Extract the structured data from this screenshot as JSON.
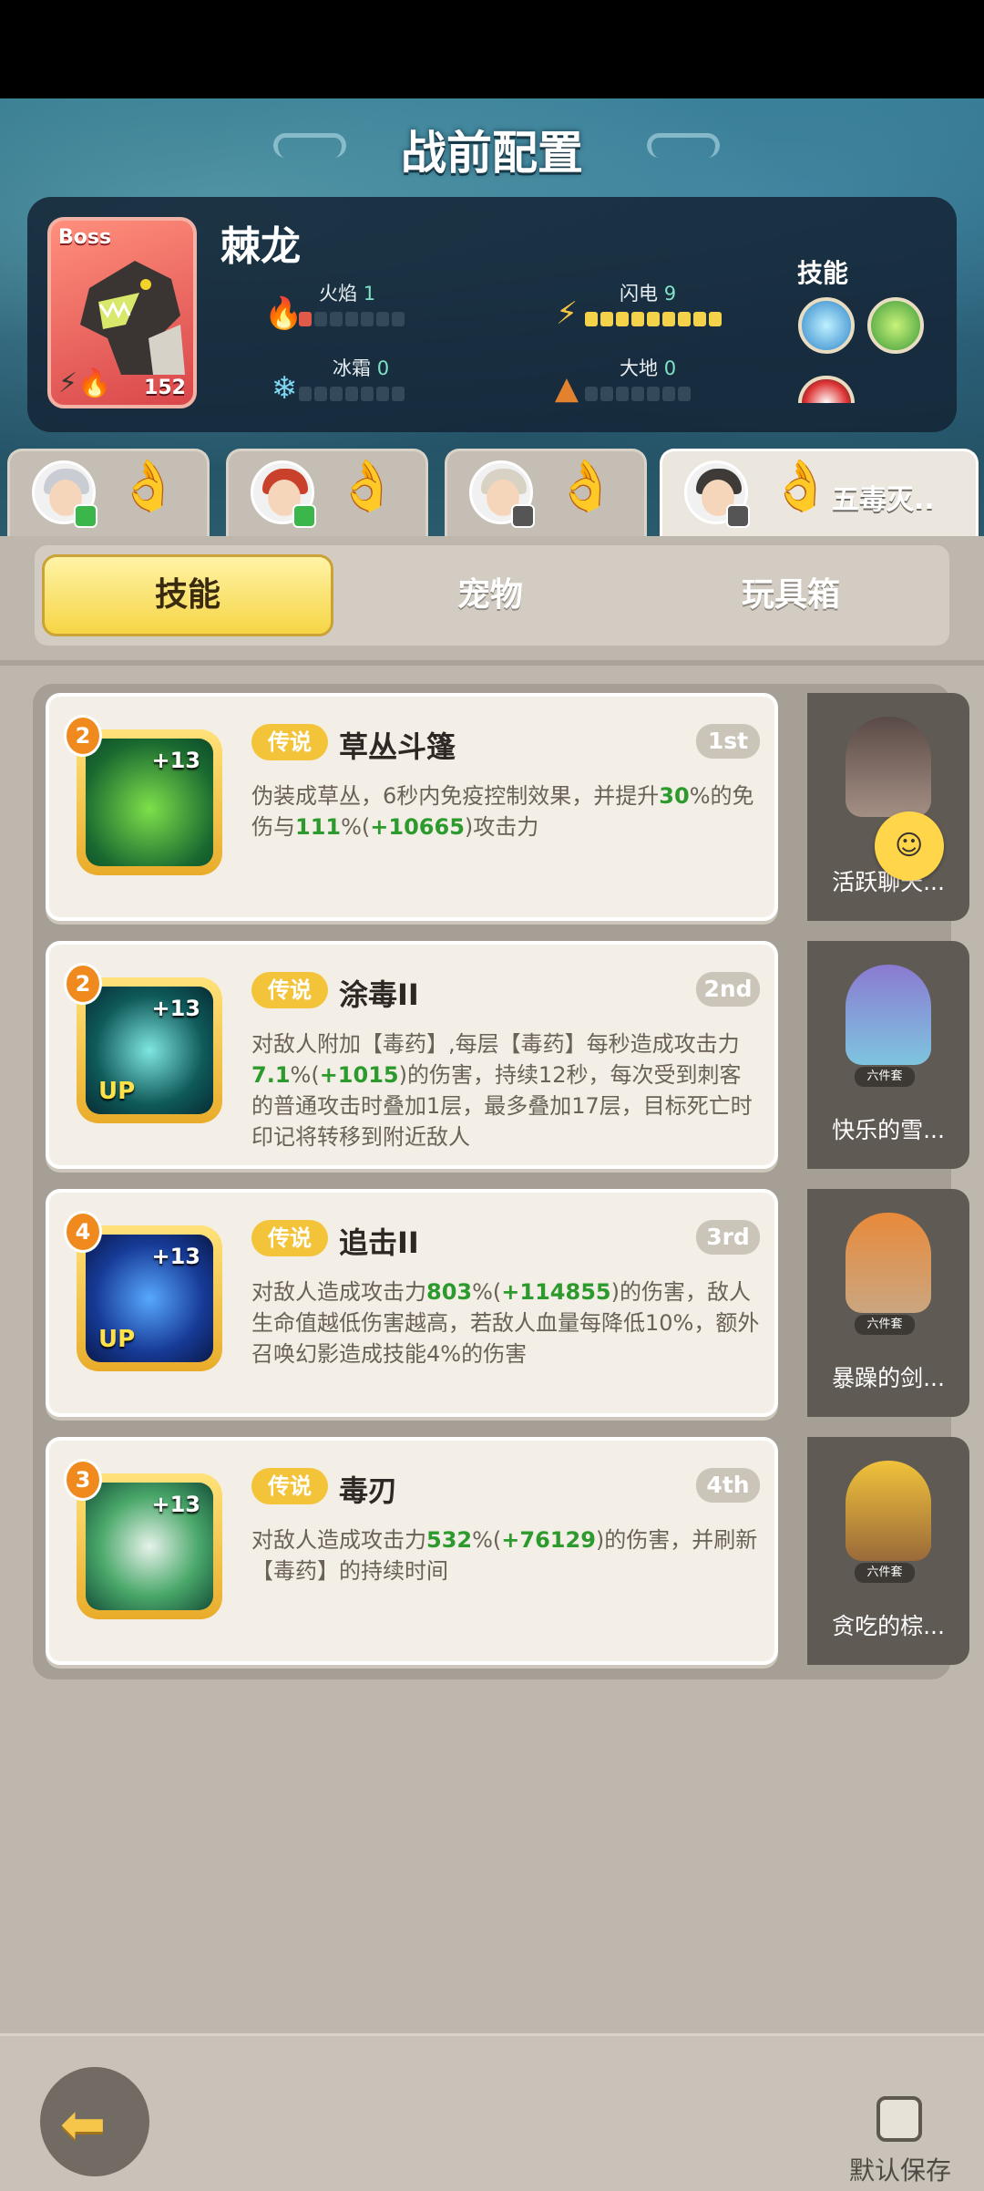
{
  "page": {
    "title": "战前配置"
  },
  "boss": {
    "tag": "Boss",
    "name": "棘龙",
    "level": "152",
    "elements": [
      {
        "label": "火焰",
        "value": "1",
        "icon": "fire-icon"
      },
      {
        "label": "闪电",
        "value": "9",
        "icon": "lightning-icon"
      },
      {
        "label": "冰霜",
        "value": "0",
        "icon": "snowflake-icon"
      },
      {
        "label": "大地",
        "value": "0",
        "icon": "earth-icon"
      }
    ],
    "skills_label": "技能"
  },
  "heroes": [
    {
      "name": ""
    },
    {
      "name": ""
    },
    {
      "name": ""
    },
    {
      "name": "五毒灭.."
    }
  ],
  "tabs": [
    "技能",
    "宠物",
    "玩具箱"
  ],
  "skills": [
    {
      "level": "2",
      "plus": "+13",
      "up": "",
      "rarity": "传说",
      "name": "草丛斗篷",
      "rank": "1st",
      "desc": [
        "伪装成草丛，6秒内免疫控制效果，并提升",
        "30",
        "%的免伤与",
        "111",
        "%(",
        "+10665",
        ")攻击力"
      ],
      "pet": "活跃聊天..."
    },
    {
      "level": "2",
      "plus": "+13",
      "up": "UP",
      "rarity": "传说",
      "name": "涂毒II",
      "rank": "2nd",
      "desc": [
        "对敌人附加【毒药】,每层【毒药】每秒造成攻击力",
        "7.1",
        "%(",
        "+1015",
        ")的伤害，持续12秒，每次受到刺客的普通攻击时叠加1层，最多叠加17层，目标死亡时印记将转移到附近敌人"
      ],
      "pet": "快乐的雪..."
    },
    {
      "level": "4",
      "plus": "+13",
      "up": "UP",
      "rarity": "传说",
      "name": "追击II",
      "rank": "3rd",
      "desc": [
        "对敌人造成攻击力",
        "803",
        "%(",
        "+114855",
        ")的伤害，敌人生命值越低伤害越高，若敌人血量每降低10%，额外召唤幻影造成技能4%的伤害"
      ],
      "pet": "暴躁的剑..."
    },
    {
      "level": "3",
      "plus": "+13",
      "up": "",
      "rarity": "传说",
      "name": "毒刃",
      "rank": "4th",
      "desc": [
        "对敌人造成攻击力",
        "532",
        "%(",
        "+76129",
        ")的伤害，并刷新【毒药】的持续时间"
      ],
      "pet": "贪吃的棕..."
    }
  ],
  "pet_badge": "六件套",
  "footer": {
    "save_label": "默认保存"
  }
}
